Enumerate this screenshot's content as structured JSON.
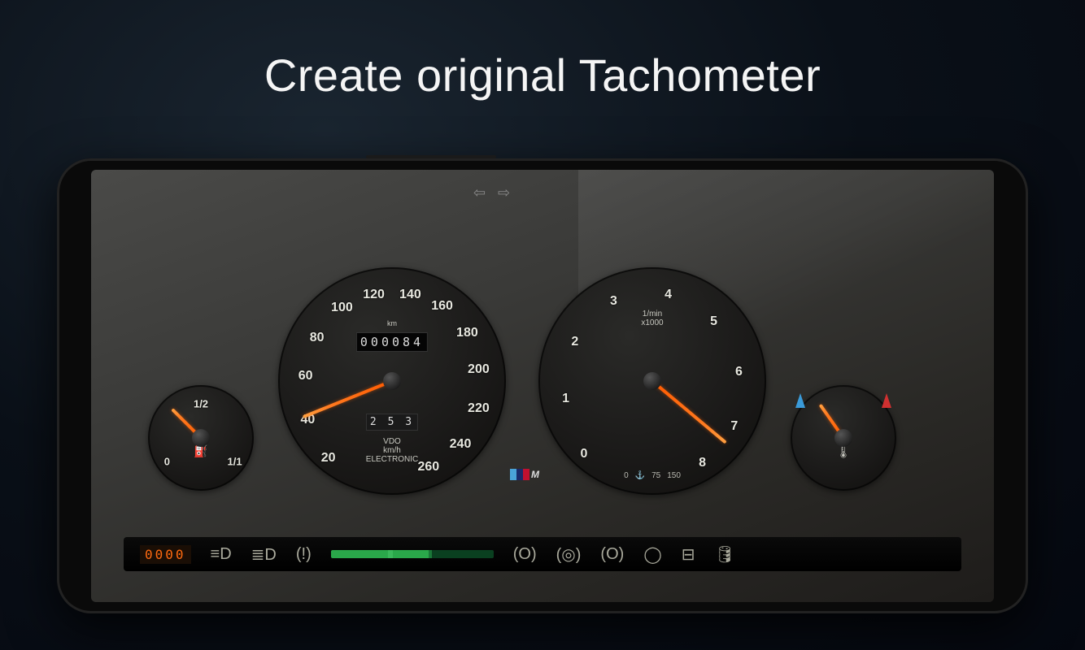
{
  "headline": "Create original Tachometer",
  "speedometer": {
    "labels": [
      "20",
      "40",
      "60",
      "80",
      "100",
      "120",
      "140",
      "160",
      "180",
      "200",
      "220",
      "240",
      "260"
    ],
    "odometer": "000084",
    "trip": "2 5 3",
    "unit_lines": "VDO\nkm/h\nELECTRONIC",
    "km_label": "km"
  },
  "tachometer": {
    "labels": [
      "0",
      "1",
      "2",
      "3",
      "4",
      "5",
      "6",
      "7",
      "8"
    ],
    "unit_lines": "1/min\nx1000",
    "oil_pressure_labels": [
      "0",
      "75",
      "150"
    ]
  },
  "fuel": {
    "labels": [
      "0",
      "1/2",
      "1/1"
    ]
  },
  "temp": {
    "icon_name": "coolant-temp-icon"
  },
  "m_badge": {
    "letter": "M"
  },
  "warning_strip": {
    "digital_readout": "0000",
    "icons": [
      "fog-light-icon",
      "headlight-icon",
      "brake-warn-icon",
      "econ-bar",
      "brake-pad-icon",
      "abs-icon",
      "brake-system-icon",
      "check-icon",
      "battery-icon",
      "oil-icon"
    ]
  }
}
